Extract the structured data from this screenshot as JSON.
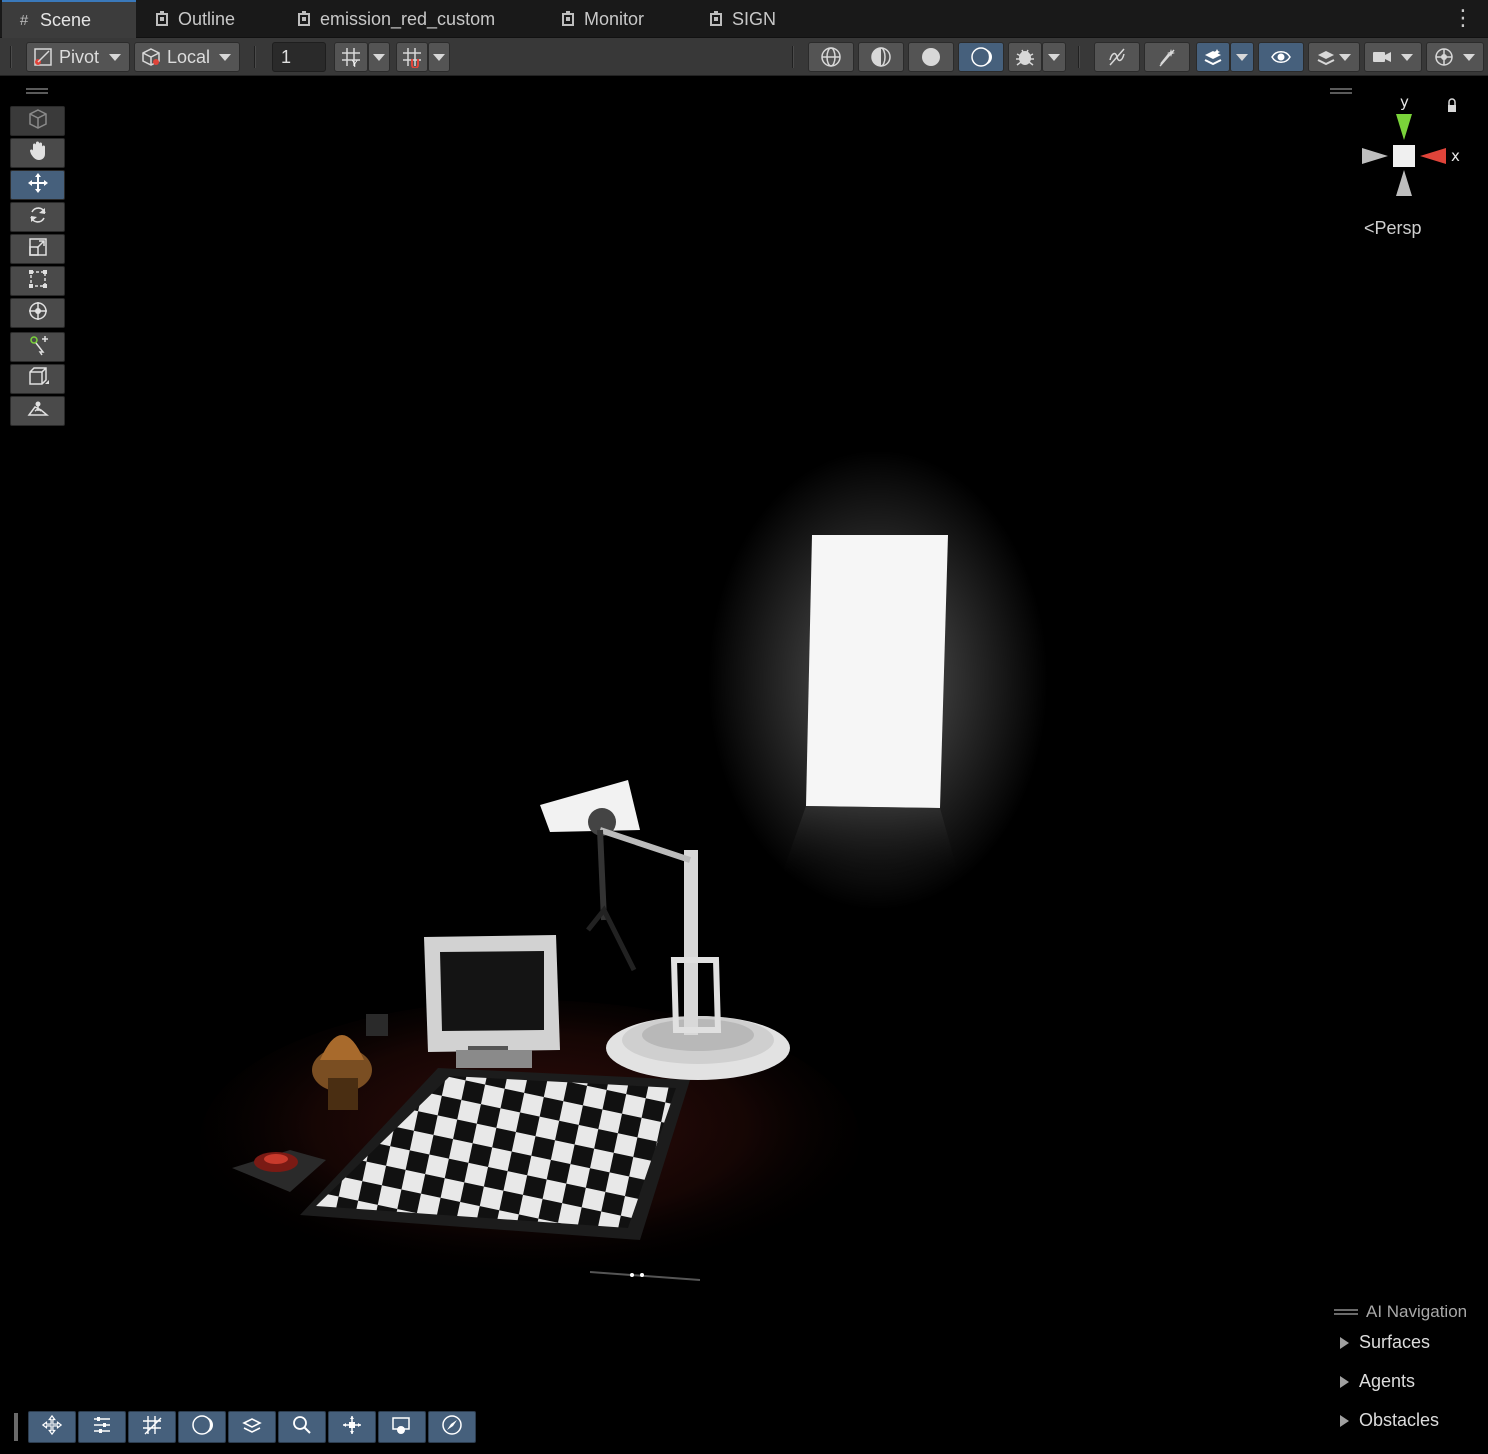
{
  "tabs": [
    {
      "label": "Scene",
      "icon": "grid-icon",
      "active": true
    },
    {
      "label": "Outline",
      "icon": "game-object-icon"
    },
    {
      "label": "emission_red_custom",
      "icon": "game-object-icon"
    },
    {
      "label": "Monitor",
      "icon": "game-object-icon"
    },
    {
      "label": "SIGN",
      "icon": "game-object-icon"
    }
  ],
  "toolbar": {
    "pivot_label": "Pivot",
    "local_label": "Local",
    "grid_snap_value": "1"
  },
  "gizmo": {
    "y_label": "y",
    "x_label": "x",
    "projection_label": "Persp"
  },
  "ai_navigation": {
    "title": "AI Navigation",
    "items": [
      "Surfaces",
      "Agents",
      "Obstacles"
    ]
  },
  "colors": {
    "active_blue": "#46607c",
    "accent": "#3a79bb",
    "gizmo_x": "#e0443a",
    "gizmo_y": "#7ad33a"
  }
}
